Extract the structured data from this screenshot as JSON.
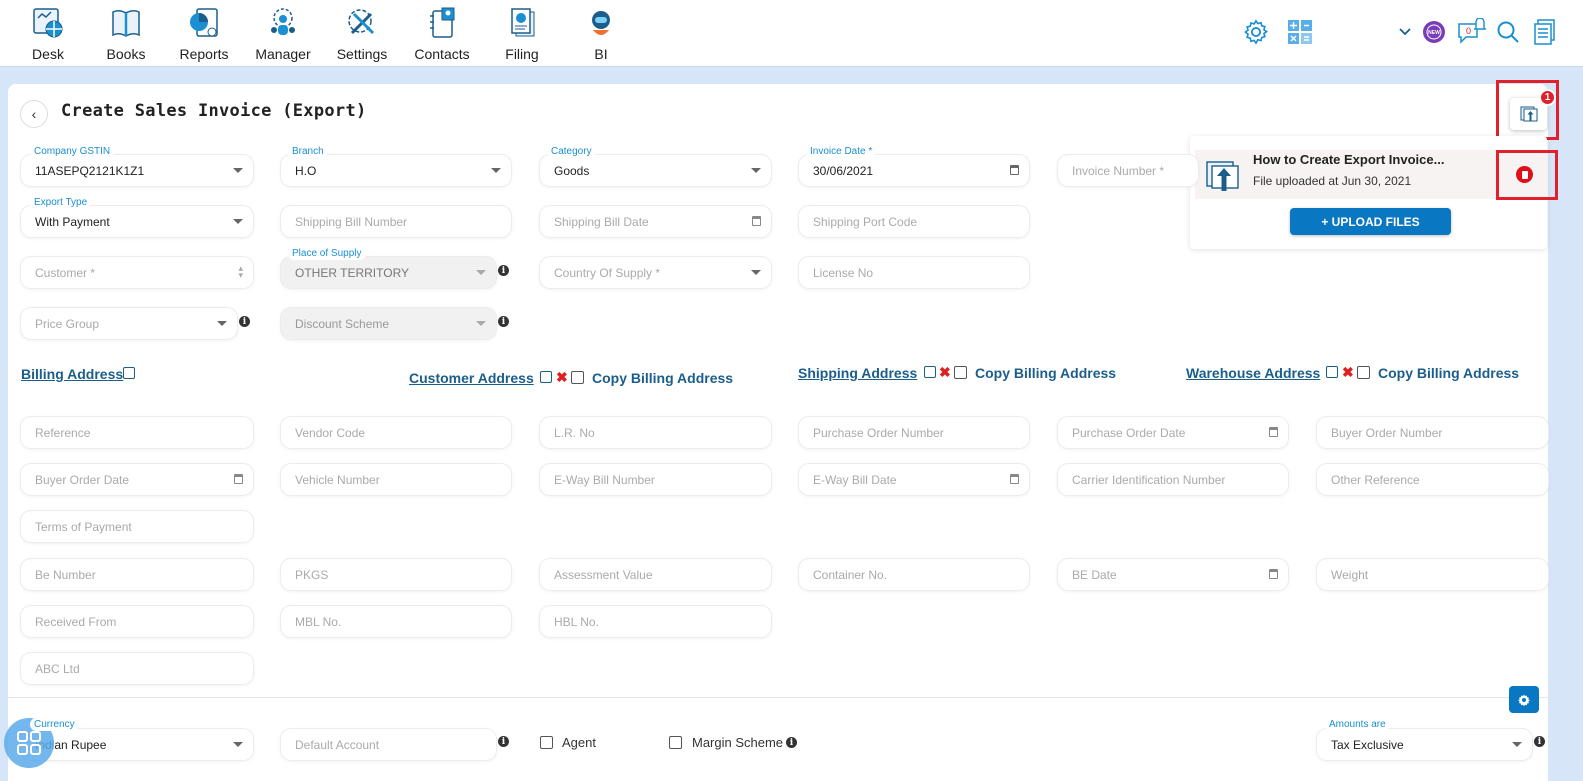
{
  "nav": [
    {
      "label": "Desk",
      "icon": "desk-icon"
    },
    {
      "label": "Books",
      "icon": "books-icon"
    },
    {
      "label": "Reports",
      "icon": "reports-icon"
    },
    {
      "label": "Manager",
      "icon": "manager-icon"
    },
    {
      "label": "Settings",
      "icon": "settings-icon"
    },
    {
      "label": "Contacts",
      "icon": "contacts-icon"
    },
    {
      "label": "Filing",
      "icon": "filing-icon"
    },
    {
      "label": "BI",
      "icon": "bi-robot-icon"
    }
  ],
  "topright": {
    "notification_count": "0",
    "new_badge": "NEW"
  },
  "page": {
    "title": "Create Sales Invoice (Export)"
  },
  "attachments": {
    "badge_count": "1",
    "file_title": "How to Create Export Invoice...",
    "file_subtitle": "File uploaded at Jun 30, 2021",
    "upload_label": "+ UPLOAD FILES"
  },
  "form": {
    "company_gstin": {
      "label": "Company GSTIN",
      "value": "11ASEPQ2121K1Z1"
    },
    "branch": {
      "label": "Branch",
      "value": "H.O"
    },
    "category": {
      "label": "Category",
      "value": "Goods"
    },
    "invoice_date": {
      "label": "Invoice Date *",
      "value": "30/06/2021"
    },
    "invoice_number": {
      "placeholder": "Invoice Number *"
    },
    "export_type": {
      "label": "Export Type",
      "value": "With Payment"
    },
    "shipping_bill_number": {
      "placeholder": "Shipping Bill Number"
    },
    "shipping_bill_date": {
      "placeholder": "Shipping Bill Date"
    },
    "shipping_port_code": {
      "placeholder": "Shipping Port Code"
    },
    "customer": {
      "placeholder": "Customer *"
    },
    "place_of_supply": {
      "label": "Place of Supply",
      "value": "OTHER TERRITORY"
    },
    "country_of_supply": {
      "placeholder": "Country Of Supply *"
    },
    "license_no": {
      "placeholder": "License No"
    },
    "price_group": {
      "placeholder": "Price Group"
    },
    "discount_scheme": {
      "placeholder": "Discount Scheme"
    }
  },
  "addresses": {
    "billing": "Billing Address",
    "customer": "Customer Address",
    "shipping": "Shipping Address",
    "warehouse": "Warehouse Address",
    "copy_label": "Copy Billing Address"
  },
  "extra_fields": [
    "Reference",
    "Vendor Code",
    "L.R. No",
    "Purchase Order Number",
    "Purchase Order Date",
    "Buyer Order Number",
    "Buyer Order Date",
    "Vehicle Number",
    "E-Way Bill Number",
    "E-Way Bill Date",
    "Carrier Identification Number",
    "Other Reference",
    "Terms of Payment",
    "Be Number",
    "PKGS",
    "Assessment Value",
    "Container No.",
    "BE Date",
    "Weight",
    "Received From",
    "MBL No.",
    "HBL No.",
    "ABC Ltd"
  ],
  "footer": {
    "currency": {
      "label": "Currency",
      "value": "Indian Rupee"
    },
    "default_account": {
      "placeholder": "Default Account"
    },
    "agent": "Agent",
    "margin_scheme": "Margin Scheme",
    "amounts_are": {
      "label": "Amounts are",
      "value": "Tax Exclusive"
    }
  }
}
